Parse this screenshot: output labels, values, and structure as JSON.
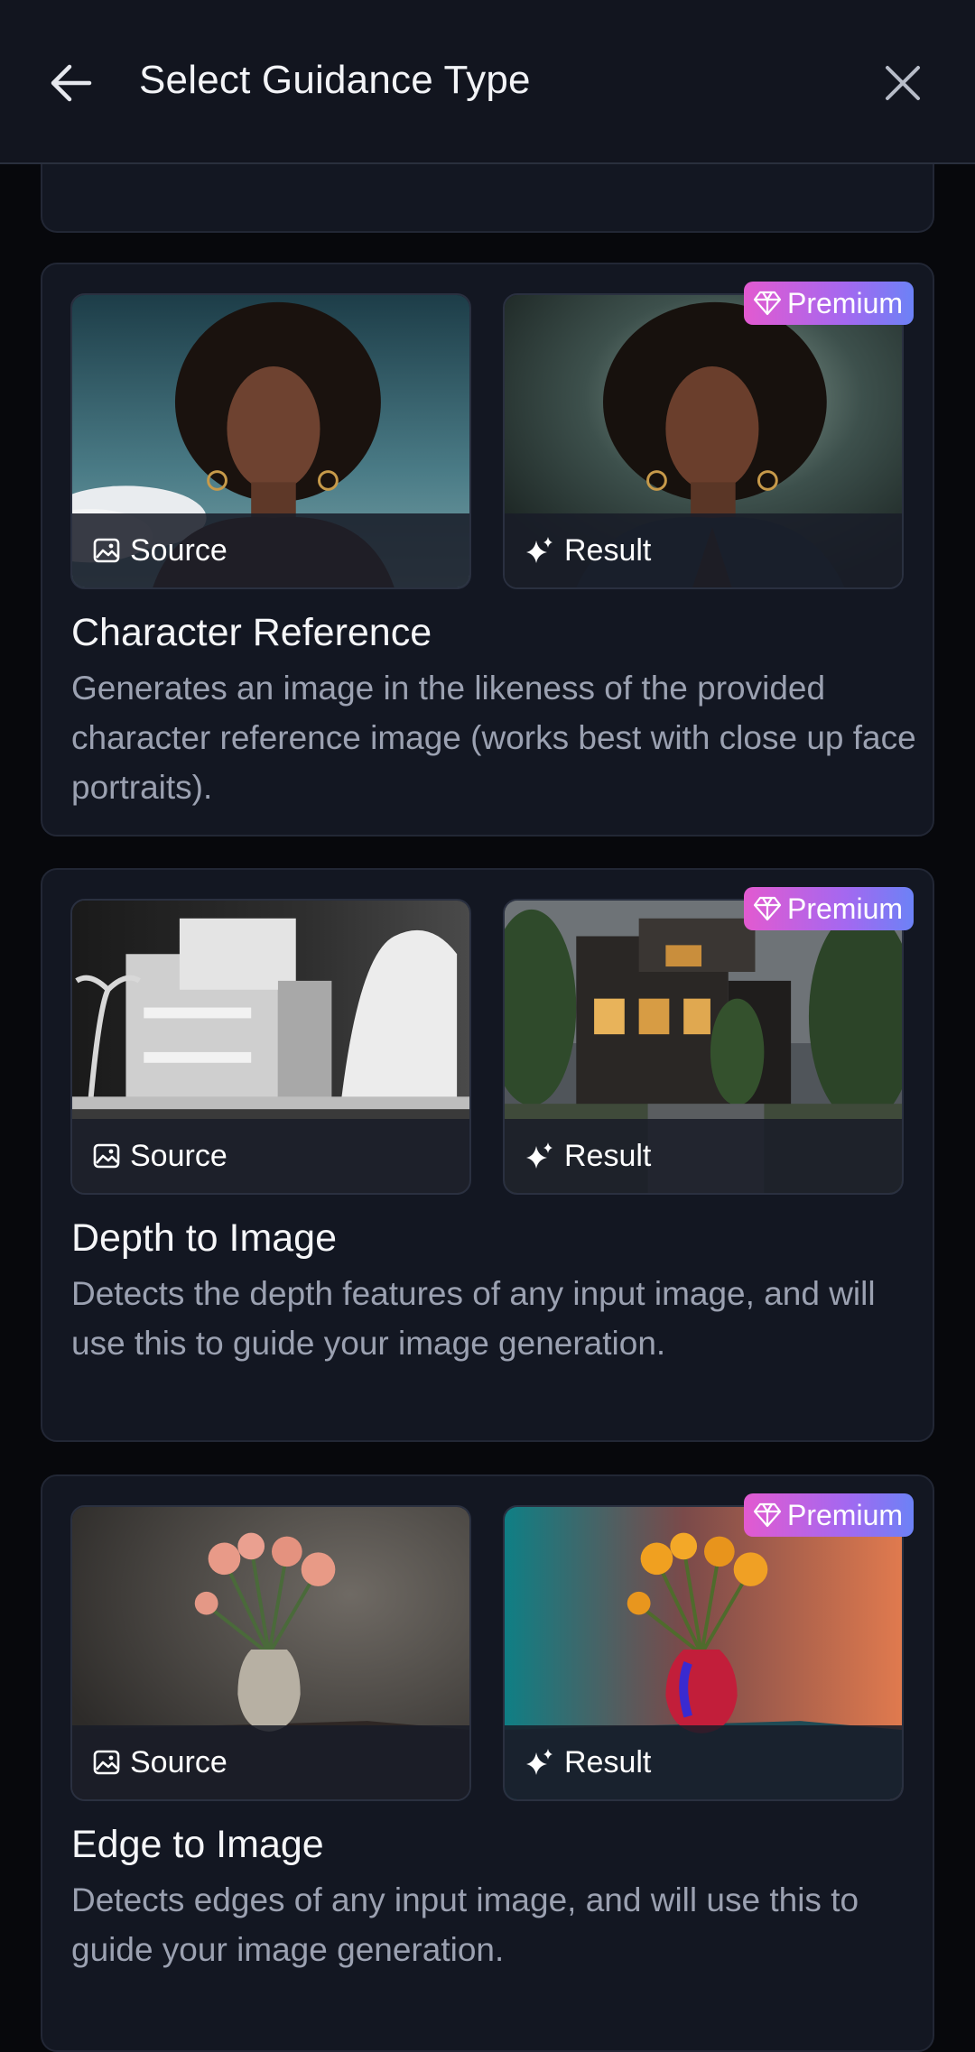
{
  "header": {
    "title": "Select Guidance Type"
  },
  "cards": [
    {
      "title": "Character Reference",
      "description": "Generates an image in the likeness of the provided character reference image (works best with close up face portraits).",
      "source_label": "Source",
      "result_label": "Result",
      "badge": "Premium"
    },
    {
      "title": "Depth to Image",
      "description": "Detects the depth features of any input image, and will use this to guide your image generation.",
      "source_label": "Source",
      "result_label": "Result",
      "badge": "Premium"
    },
    {
      "title": "Edge to Image",
      "description": "Detects edges of any input image, and will use this to guide your image generation.",
      "source_label": "Source",
      "result_label": "Result",
      "badge": "Premium"
    }
  ],
  "colors": {
    "background": "#07080c",
    "header": "#12151f",
    "card": "#131722",
    "muted_text": "#9ba1b1",
    "premium_gradient_start": "#e25ad0",
    "premium_gradient_end": "#6c82f6"
  },
  "icons": {
    "back": "arrow-left-icon",
    "close": "close-icon",
    "source": "image-icon",
    "result": "sparkles-icon",
    "premium": "diamond-icon"
  }
}
